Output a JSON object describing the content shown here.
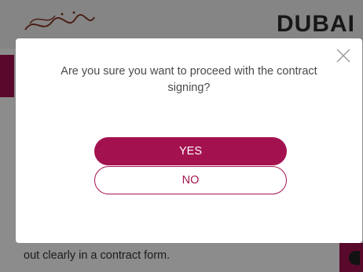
{
  "header": {
    "gov_logo_text": "حكومة دبي",
    "dubai_logo_text": "DUBAI"
  },
  "background": {
    "body_text": "out clearly in a contract form."
  },
  "dialog": {
    "message": "Are you sure you want to proceed with the contract signing?",
    "yes_label": "YES",
    "no_label": "NO"
  },
  "colors": {
    "accent": "#a3124f",
    "overlay": "rgba(0,0,0,0.45)",
    "text": "#4a4a4a"
  },
  "icons": {
    "close": "close-icon"
  }
}
